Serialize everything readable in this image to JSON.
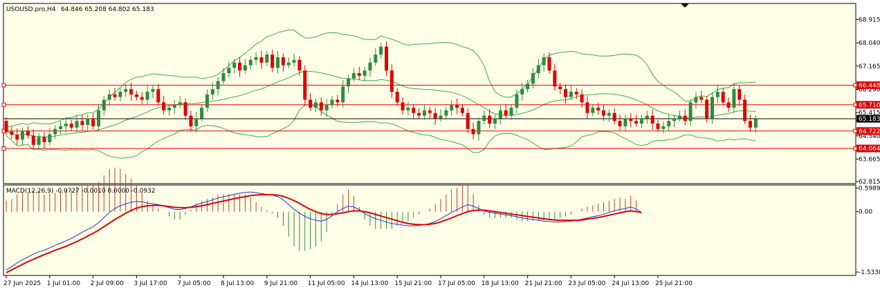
{
  "header": {
    "symbol": "USOUSD.pro,H4",
    "ohlc": "64.846 65.208 64.802 65.183"
  },
  "macd_header": "MACD(12,26,9) -0.0727 -0.0010 0.0000 -0.0932",
  "colors": {
    "background": "#ffffe8",
    "bull": "#2e8b40",
    "bear": "#e00000",
    "bands": "#3aa84a",
    "level": "#e00000",
    "macd_line": "#1f2fd8",
    "signal": "#e00000",
    "histogram": "#c0392b"
  },
  "chart_data": [
    {
      "type": "candlestick",
      "y_ticks": [
        "68.915",
        "68.040",
        "67.165",
        "66.290",
        "65.415",
        "64.540",
        "63.665",
        "62.815"
      ],
      "y_tick_values": [
        68.915,
        68.04,
        67.165,
        66.29,
        65.415,
        64.54,
        63.665,
        62.815
      ],
      "ylim": [
        62.74,
        69.5
      ],
      "x_ticks": [
        "27 Jun 2025",
        "1 Jul 01:00",
        "2 Jul 09:00",
        "3 Jul 17:00",
        "7 Jul 05:00",
        "8 Jul 13:00",
        "9 Jul 21:00",
        "11 Jul 05:00",
        "14 Jul 13:00",
        "15 Jul 21:00",
        "17 Jul 05:00",
        "18 Jul 13:00",
        "21 Jul 21:00",
        "23 Jul 05:00",
        "24 Jul 13:00",
        "25 Jul 21:00"
      ],
      "x_tick_bars": [
        0,
        8,
        16,
        24,
        32,
        40,
        48,
        56,
        64,
        72,
        80,
        88,
        96,
        104,
        112,
        120
      ],
      "levels": [
        {
          "label": "66.448",
          "value": 66.448
        },
        {
          "label": "65.710",
          "value": 65.71
        },
        {
          "label": "64.722",
          "value": 64.722
        },
        {
          "label": "64.064",
          "value": 64.064
        }
      ],
      "current_price": {
        "label": "65.183",
        "value": 65.183
      },
      "close": [
        64.7,
        64.58,
        64.4,
        64.72,
        64.55,
        64.2,
        64.5,
        64.3,
        64.6,
        64.8,
        64.9,
        65.0,
        64.85,
        65.1,
        64.95,
        65.2,
        64.9,
        65.5,
        65.9,
        66.1,
        66.0,
        66.2,
        66.3,
        66.1,
        66.0,
        65.9,
        66.2,
        66.3,
        65.8,
        65.5,
        65.6,
        65.7,
        65.8,
        65.3,
        64.9,
        65.2,
        65.6,
        66.1,
        66.3,
        66.6,
        66.9,
        67.1,
        67.3,
        67.0,
        67.2,
        67.4,
        67.5,
        67.3,
        67.6,
        67.1,
        67.5,
        67.2,
        67.3,
        67.4,
        67.0,
        65.9,
        65.6,
        65.8,
        65.5,
        65.7,
        65.9,
        65.8,
        66.4,
        66.7,
        66.9,
        66.8,
        67.0,
        67.3,
        67.6,
        67.9,
        67.0,
        66.2,
        65.8,
        65.5,
        65.6,
        65.4,
        65.3,
        65.5,
        65.4,
        65.2,
        65.3,
        65.5,
        65.7,
        65.6,
        65.4,
        64.8,
        64.6,
        65.1,
        65.3,
        65.0,
        65.2,
        65.5,
        65.3,
        65.6,
        66.1,
        66.3,
        66.5,
        66.9,
        67.2,
        67.5,
        67.0,
        66.4,
        66.3,
        66.0,
        66.2,
        66.1,
        65.8,
        65.4,
        65.6,
        65.5,
        65.3,
        65.4,
        65.1,
        64.9,
        65.2,
        65.1,
        65.0,
        65.2,
        65.3,
        65.0,
        64.8,
        64.9,
        65.1,
        65.2,
        65.3,
        65.1,
        65.8,
        66.0,
        65.9,
        65.2,
        66.0,
        66.2,
        65.8,
        65.6,
        66.3,
        65.9,
        65.1,
        64.85,
        65.18
      ],
      "open": [
        65.1,
        64.7,
        64.58,
        64.4,
        64.72,
        64.55,
        64.2,
        64.5,
        64.3,
        64.6,
        64.8,
        64.9,
        65.0,
        64.85,
        65.1,
        64.95,
        65.2,
        64.9,
        65.5,
        65.9,
        66.1,
        66.0,
        66.2,
        66.3,
        66.1,
        66.0,
        65.9,
        66.2,
        66.3,
        65.8,
        65.5,
        65.6,
        65.7,
        65.8,
        65.3,
        64.9,
        65.2,
        65.6,
        66.1,
        66.3,
        66.6,
        66.9,
        67.1,
        67.3,
        67.0,
        67.2,
        67.4,
        67.5,
        67.3,
        67.6,
        67.1,
        67.5,
        67.2,
        67.3,
        67.4,
        67.0,
        65.9,
        65.6,
        65.8,
        65.5,
        65.7,
        65.9,
        65.8,
        66.4,
        66.7,
        66.9,
        66.8,
        67.0,
        67.3,
        67.6,
        67.9,
        67.0,
        66.2,
        65.8,
        65.5,
        65.6,
        65.4,
        65.3,
        65.5,
        65.4,
        65.2,
        65.3,
        65.5,
        65.7,
        65.6,
        65.4,
        64.8,
        64.6,
        65.1,
        65.3,
        65.0,
        65.2,
        65.5,
        65.3,
        65.6,
        66.1,
        66.3,
        66.5,
        66.9,
        67.2,
        67.5,
        67.0,
        66.4,
        66.3,
        66.0,
        66.2,
        66.1,
        65.8,
        65.4,
        65.6,
        65.5,
        65.3,
        65.4,
        65.1,
        64.9,
        65.2,
        65.1,
        65.0,
        65.2,
        65.3,
        65.0,
        64.8,
        64.9,
        65.1,
        65.2,
        65.3,
        65.1,
        65.8,
        66.0,
        65.9,
        65.2,
        66.0,
        66.2,
        65.8,
        65.6,
        66.3,
        65.9,
        65.1,
        64.85
      ]
    },
    {
      "type": "macd",
      "params": "MACD(12,26,9)",
      "values": {
        "macd": -0.0727,
        "signal": -0.001,
        "histogram": 0.0,
        "diff": -0.0932
      },
      "y_ticks": [
        "0.5989",
        "0.00",
        "-1.5338"
      ],
      "y_tick_values": [
        0.5989,
        0.0,
        -1.5338
      ],
      "ylim": [
        -1.62,
        0.66
      ],
      "macd_line": [
        -1.48,
        -1.4,
        -1.3,
        -1.22,
        -1.15,
        -1.08,
        -1.02,
        -0.98,
        -0.92,
        -0.86,
        -0.8,
        -0.74,
        -0.68,
        -0.6,
        -0.52,
        -0.45,
        -0.38,
        -0.28,
        -0.15,
        -0.02,
        0.08,
        0.15,
        0.2,
        0.24,
        0.26,
        0.25,
        0.22,
        0.2,
        0.18,
        0.15,
        0.1,
        0.06,
        0.05,
        0.08,
        0.12,
        0.18,
        0.22,
        0.26,
        0.3,
        0.35,
        0.38,
        0.41,
        0.44,
        0.47,
        0.49,
        0.5,
        0.48,
        0.46,
        0.44,
        0.42,
        0.38,
        0.3,
        0.18,
        0.06,
        -0.04,
        -0.12,
        -0.18,
        -0.22,
        -0.24,
        -0.2,
        -0.1,
        0.0,
        0.08,
        0.14,
        0.12,
        0.05,
        -0.05,
        -0.12,
        -0.18,
        -0.22,
        -0.26,
        -0.3,
        -0.32,
        -0.34,
        -0.36,
        -0.36,
        -0.35,
        -0.33,
        -0.3,
        -0.25,
        -0.18,
        -0.1,
        -0.02,
        0.05,
        0.12,
        0.18,
        0.14,
        0.08,
        0.02,
        -0.02,
        -0.04,
        -0.06,
        -0.08,
        -0.1,
        -0.13,
        -0.16,
        -0.18,
        -0.2,
        -0.22,
        -0.24,
        -0.25,
        -0.26,
        -0.26,
        -0.25,
        -0.24,
        -0.22,
        -0.19,
        -0.16,
        -0.13,
        -0.1,
        -0.06,
        -0.02,
        0.02,
        0.06,
        0.08,
        0.12,
        0.07,
        -0.02
      ],
      "signal_line": [
        -1.55,
        -1.48,
        -1.41,
        -1.34,
        -1.27,
        -1.21,
        -1.15,
        -1.09,
        -1.04,
        -0.98,
        -0.93,
        -0.88,
        -0.82,
        -0.76,
        -0.69,
        -0.62,
        -0.55,
        -0.47,
        -0.38,
        -0.29,
        -0.2,
        -0.12,
        -0.04,
        0.03,
        0.09,
        0.13,
        0.15,
        0.16,
        0.16,
        0.15,
        0.13,
        0.11,
        0.1,
        0.1,
        0.11,
        0.13,
        0.15,
        0.18,
        0.21,
        0.24,
        0.27,
        0.3,
        0.33,
        0.36,
        0.38,
        0.41,
        0.42,
        0.43,
        0.43,
        0.43,
        0.42,
        0.39,
        0.34,
        0.28,
        0.21,
        0.13,
        0.06,
        0.0,
        -0.05,
        -0.07,
        -0.07,
        -0.05,
        -0.03,
        0.0,
        0.02,
        0.02,
        0.0,
        -0.03,
        -0.07,
        -0.11,
        -0.15,
        -0.19,
        -0.23,
        -0.27,
        -0.3,
        -0.32,
        -0.33,
        -0.33,
        -0.32,
        -0.3,
        -0.26,
        -0.21,
        -0.16,
        -0.1,
        -0.05,
        0.0,
        0.03,
        0.04,
        0.04,
        0.02,
        0.0,
        -0.02,
        -0.04,
        -0.06,
        -0.08,
        -0.1,
        -0.12,
        -0.14,
        -0.16,
        -0.18,
        -0.2,
        -0.21,
        -0.22,
        -0.22,
        -0.22,
        -0.22,
        -0.21,
        -0.19,
        -0.17,
        -0.15,
        -0.12,
        -0.09,
        -0.06,
        -0.03,
        0.0,
        0.02,
        0.0,
        -0.02
      ]
    }
  ]
}
